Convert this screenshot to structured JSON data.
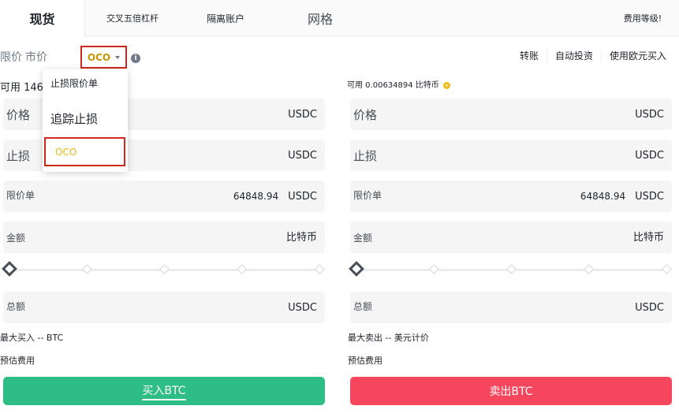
{
  "tabs": [
    "现货",
    "交叉五倍杠杆",
    "隔离账户",
    "网格",
    "费用等级!"
  ],
  "order_type": {
    "limit": "限价",
    "market": "市价",
    "selected": "OCO"
  },
  "right_links": [
    "转账",
    "自动投资",
    "使用欧元买入"
  ],
  "available": {
    "left": "可用 146",
    "right": "可用 0.00634894 比特币"
  },
  "buy": {
    "price_label": "价格",
    "price_unit": "USDC",
    "stop_label": "止损",
    "stop_unit": "USDC",
    "limit_label": "限价单",
    "limit_value": "64848.94",
    "limit_unit": "USDC",
    "amount_label": "金额",
    "amount_unit": "比特币",
    "total_label": "总额",
    "total_unit": "USDC",
    "max_line": "最大买入 -- BTC",
    "fee_line": "预估费用",
    "button": "买入BTC"
  },
  "sell": {
    "price_label": "价格",
    "price_unit": "USDC",
    "stop_label": "止损",
    "stop_unit": "USDC",
    "limit_label": "限价单",
    "limit_value": "64848.94",
    "limit_unit": "USDC",
    "amount_label": "金额",
    "amount_unit": "比特币",
    "total_label": "总额",
    "total_unit": "USDC",
    "max_line": "最大卖出 -- 美元计价",
    "fee_line": "预估费用",
    "button": "卖出BTC"
  },
  "dropdown": [
    "止损限价单",
    "追踪止损",
    "OCO"
  ],
  "colors": {
    "buy": "#2ebd85",
    "sell": "#f6465d",
    "accent": "#f0b90b",
    "highlight": "#d0281d"
  }
}
